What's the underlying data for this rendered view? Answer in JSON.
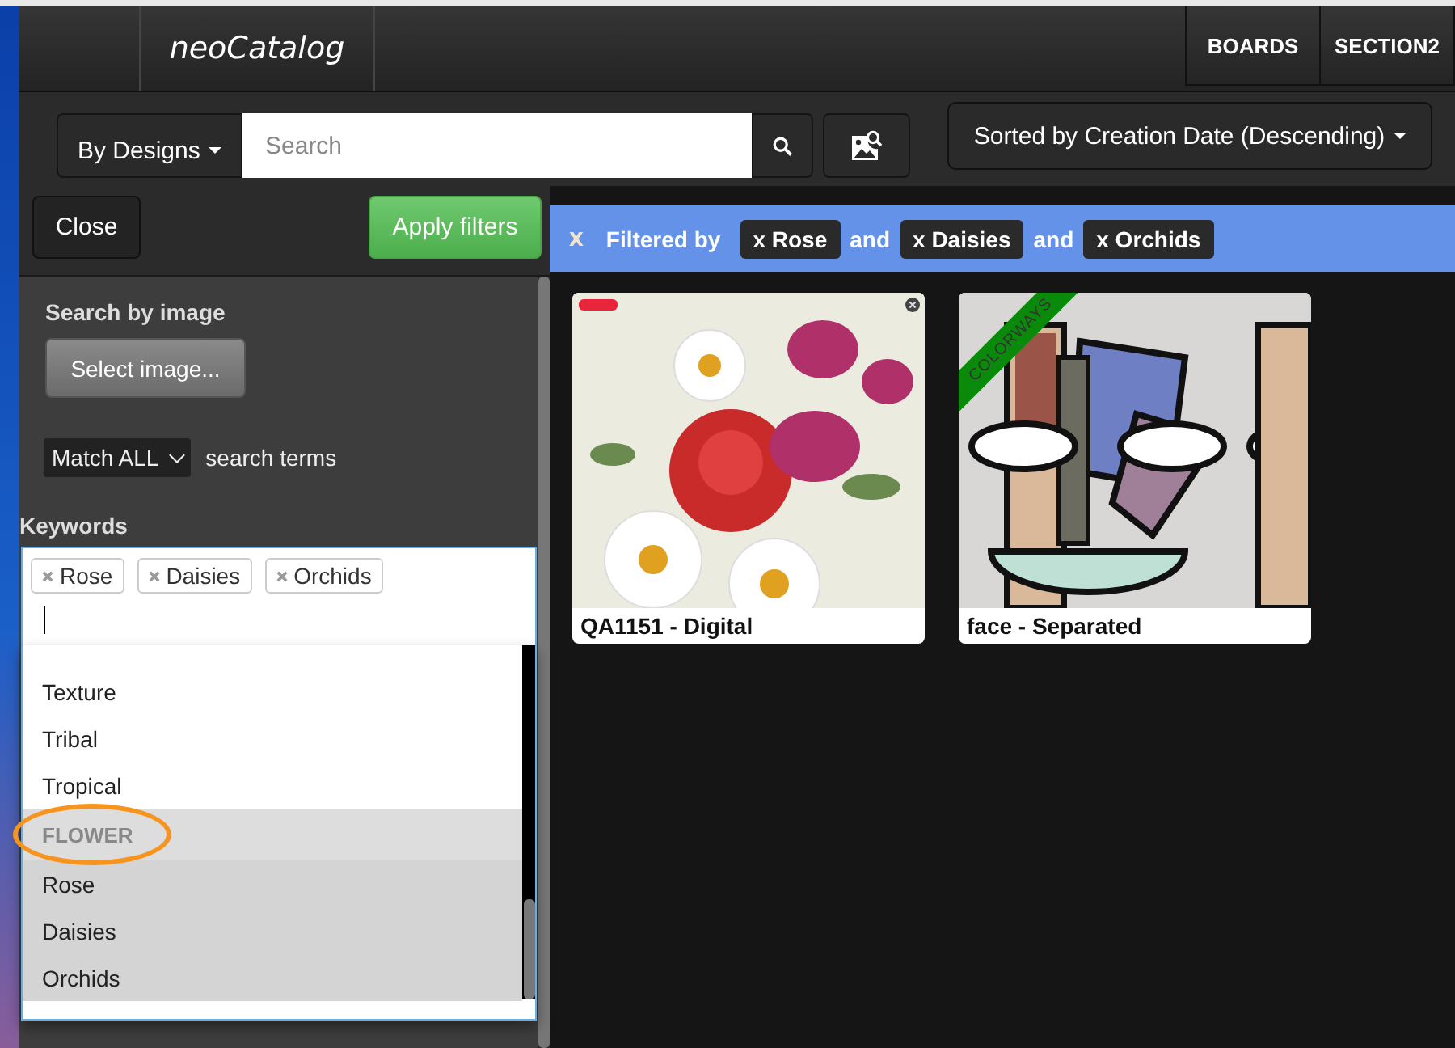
{
  "navbar": {
    "brand": "neoCatalog",
    "links": [
      {
        "label": "BOARDS"
      },
      {
        "label": "SECTION2"
      }
    ]
  },
  "toolbar": {
    "scope_dropdown": "By Designs",
    "search": {
      "placeholder": "Search"
    },
    "sort_dropdown": "Sorted by Creation Date (Descending)"
  },
  "filter_panel": {
    "close_button": "Close",
    "apply_button": "Apply filters",
    "image_search": {
      "heading": "Search by image",
      "button": "Select image..."
    },
    "match": {
      "value": "Match ALL",
      "suffix": "search terms"
    },
    "keywords": {
      "label": "Keywords",
      "tags": [
        "Rose",
        "Daisies",
        "Orchids"
      ],
      "options": [
        {
          "kind": "option",
          "label": "Texture",
          "selected": false
        },
        {
          "kind": "option",
          "label": "Tribal",
          "selected": false
        },
        {
          "kind": "option",
          "label": "Tropical",
          "selected": false
        },
        {
          "kind": "group",
          "label": "FLOWER",
          "annotated": true
        },
        {
          "kind": "option",
          "label": "Rose",
          "selected": true
        },
        {
          "kind": "option",
          "label": "Daisies",
          "selected": true
        },
        {
          "kind": "option",
          "label": "Orchids",
          "selected": true
        }
      ]
    }
  },
  "filter_bar": {
    "clear": "x",
    "label": "Filtered by",
    "items": [
      {
        "kind": "chip",
        "label": "x Rose"
      },
      {
        "kind": "joiner",
        "label": "and"
      },
      {
        "kind": "chip",
        "label": "x Daisies"
      },
      {
        "kind": "joiner",
        "label": "and"
      },
      {
        "kind": "chip",
        "label": "x Orchids"
      }
    ]
  },
  "results": [
    {
      "title": "QA1151 - Digital",
      "kind": "flowers",
      "marked": true
    },
    {
      "title": "face - Separated",
      "kind": "abstract-face",
      "ribbon": "COLORWAYS",
      "marked": false
    }
  ]
}
